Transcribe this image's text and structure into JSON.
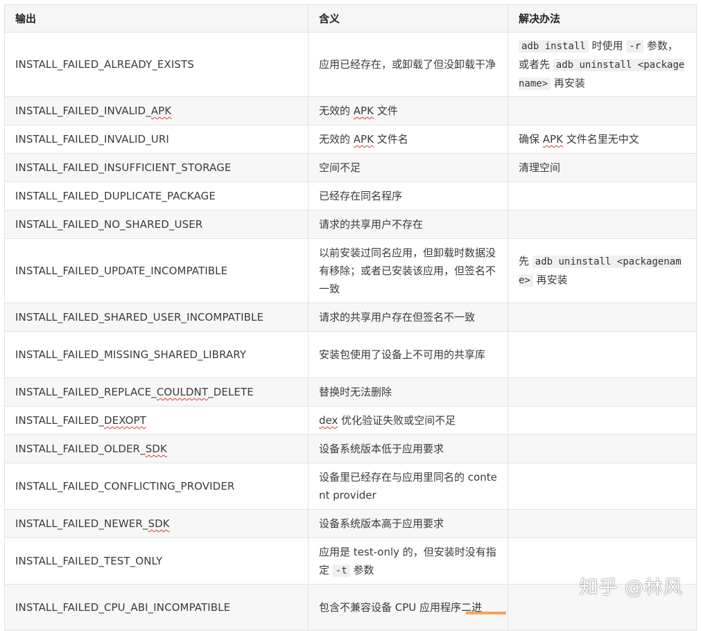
{
  "table": {
    "headers": [
      "输出",
      "含义",
      "解决办法"
    ],
    "rows": [
      {
        "output": "INSTALL_FAILED_ALREADY_EXISTS",
        "meaning": "应用已经存在，或卸载了但没卸载干净",
        "solution": {
          "code1": "adb install",
          "text1": " 时使用 ",
          "code2": "-r",
          "text2": " 参数，或者先 ",
          "code3": "adb uninstall <packagename>",
          "text3": " 再安装"
        }
      },
      {
        "output_prefix": "INSTALL_FAILED_INVALID_",
        "output_marked": "APK",
        "meaning_prefix": "无效的 ",
        "meaning_marked": "APK",
        "meaning_suffix": " 文件",
        "solution": ""
      },
      {
        "output": "INSTALL_FAILED_INVALID_URI",
        "meaning_prefix": "无效的 ",
        "meaning_marked": "APK",
        "meaning_suffix": " 文件名",
        "solution_prefix": "确保 ",
        "solution_marked": "APK",
        "solution_suffix": " 文件名里无中文"
      },
      {
        "output": "INSTALL_FAILED_INSUFFICIENT_STORAGE",
        "meaning": "空间不足",
        "solution": "清理空间"
      },
      {
        "output": "INSTALL_FAILED_DUPLICATE_PACKAGE",
        "meaning": "已经存在同名程序",
        "solution": ""
      },
      {
        "output": "INSTALL_FAILED_NO_SHARED_USER",
        "meaning": "请求的共享用户不存在",
        "solution": ""
      },
      {
        "output": "INSTALL_FAILED_UPDATE_INCOMPATIBLE",
        "meaning": "以前安装过同名应用，但卸载时数据没有移除；或者已安装该应用，但签名不一致",
        "solution": {
          "text1": "先 ",
          "code1": "adb uninstall <packagename>",
          "text2": " 再安装"
        }
      },
      {
        "output": "INSTALL_FAILED_SHARED_USER_INCOMPATIBLE",
        "meaning": "请求的共享用户存在但签名不一致",
        "solution": ""
      },
      {
        "output": "INSTALL_FAILED_MISSING_SHARED_LIBRARY",
        "meaning": "安装包使用了设备上不可用的共享库",
        "solution": ""
      },
      {
        "output_prefix": "INSTALL_FAILED_REPLACE_",
        "output_marked": "COULDNT",
        "output_suffix": "_DELETE",
        "meaning": "替换时无法删除",
        "solution": ""
      },
      {
        "output_prefix": "INSTALL_FAILED_",
        "output_marked": "DEXOPT",
        "meaning_marked": "dex",
        "meaning_suffix": " 优化验证失败或空间不足",
        "solution": ""
      },
      {
        "output_prefix": "INSTALL_FAILED_OLDER_",
        "output_marked": "SDK",
        "meaning": "设备系统版本低于应用要求",
        "solution": ""
      },
      {
        "output": "INSTALL_FAILED_CONFLICTING_PROVIDER",
        "meaning": "设备里已经存在与应用里同名的 content provider",
        "solution": ""
      },
      {
        "output_prefix": "INSTALL_FAILED_NEWER_",
        "output_marked": "SDK",
        "meaning": "设备系统版本高于应用要求",
        "solution": ""
      },
      {
        "output": "INSTALL_FAILED_TEST_ONLY",
        "meaning_prefix": "应用是 test-only 的，但安装时没有指定 ",
        "meaning_code": "-t",
        "meaning_suffix": " 参数",
        "solution": ""
      },
      {
        "output": "INSTALL_FAILED_CPU_ABI_INCOMPATIBLE",
        "meaning": "包含不兼容设备 CPU 应用程序二进",
        "solution": ""
      }
    ]
  },
  "watermark": "知乎 @林风",
  "colors": {
    "border": "#e3e3e3",
    "stripe": "#f7f7f7",
    "spellcheck": "#d33333",
    "accent_tab": "#f4a25a"
  }
}
